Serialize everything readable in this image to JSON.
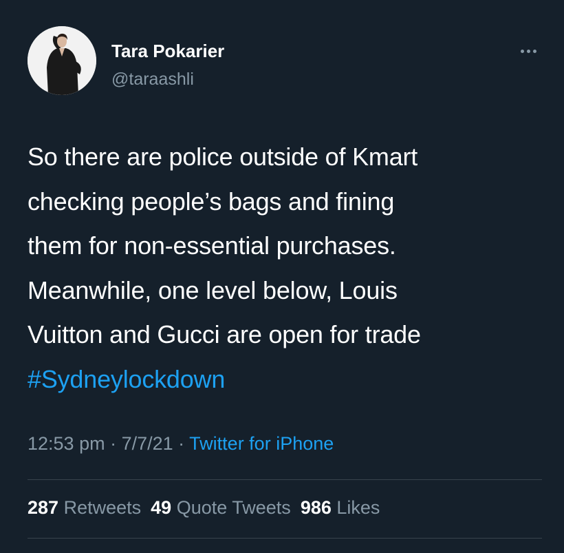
{
  "author": {
    "display_name": "Tara Pokarier",
    "handle": "@taraashli"
  },
  "tweet": {
    "lines": [
      "So there are police outside of Kmart",
      "checking people’s bags and fining",
      "them for non-essential purchases.",
      "Meanwhile, one level below, Louis",
      "Vuitton and Gucci are open for trade"
    ],
    "hashtag": "#Sydneylockdown"
  },
  "meta": {
    "time": "12:53 pm",
    "sep1": " · ",
    "date": "7/7/21",
    "sep2": " · ",
    "source": "Twitter for iPhone"
  },
  "stats": {
    "retweets_count": "287",
    "retweets_label": "Retweets",
    "quotes_count": "49",
    "quotes_label": "Quote Tweets",
    "likes_count": "986",
    "likes_label": "Likes"
  },
  "colors": {
    "background": "#15202b",
    "link": "#1da1f2",
    "secondary_text": "#8899a6",
    "divider": "#38444d"
  },
  "icons": {
    "more": "more-horizontal-icon",
    "avatar": "avatar"
  }
}
